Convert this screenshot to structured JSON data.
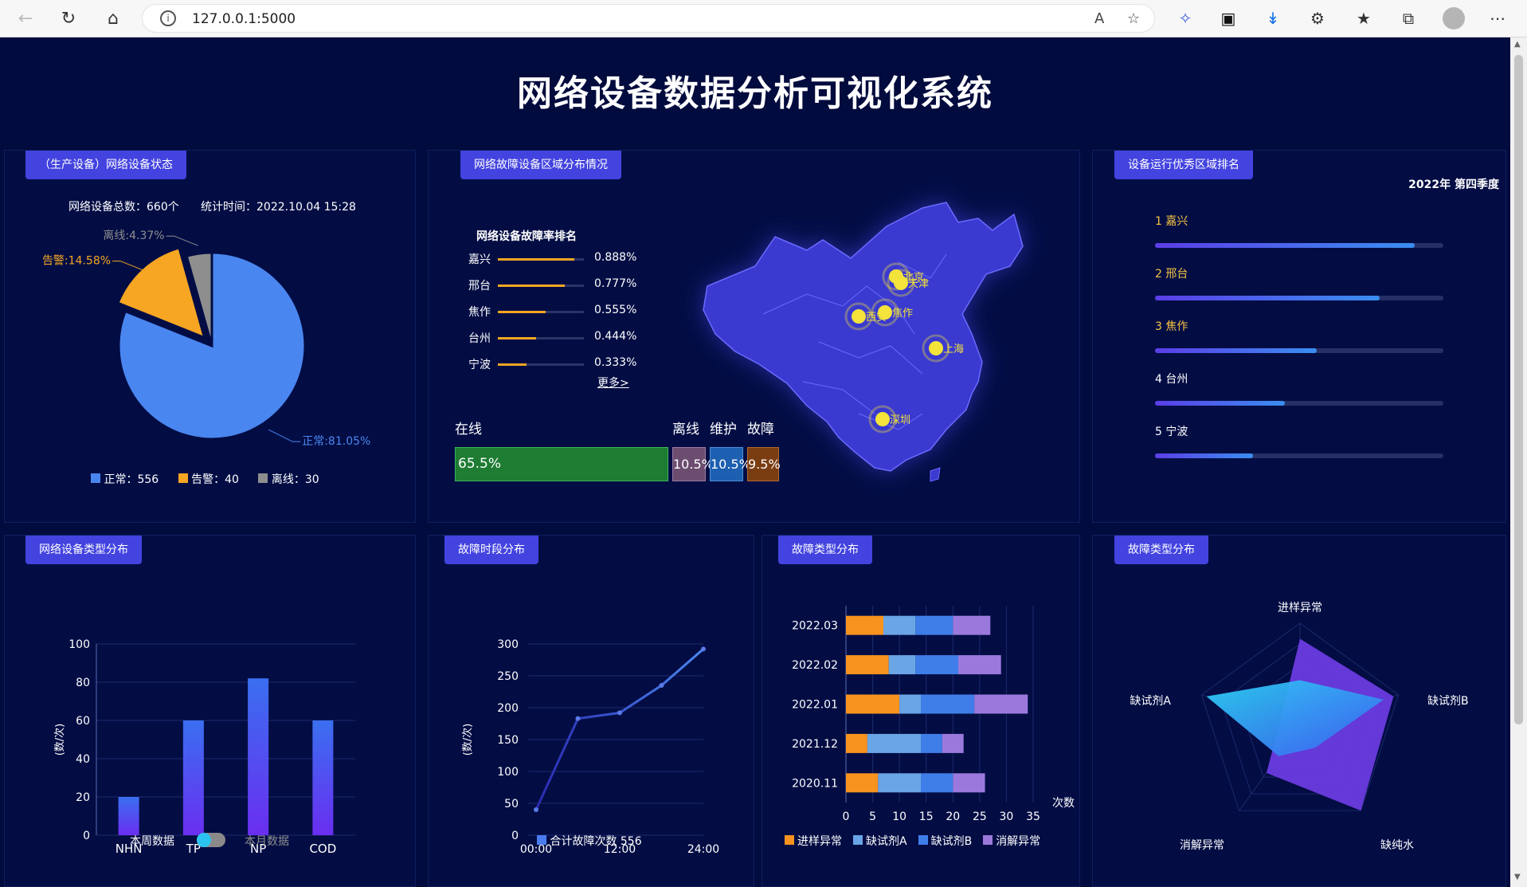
{
  "browser": {
    "url": "127.0.0.1:5000"
  },
  "title": "网络设备数据分析可视化系统",
  "p1": {
    "tag": "（生产设备）网络设备状态",
    "total": "网络设备总数：660个",
    "time": "统计时间：2022.10.04 15:28",
    "slices": [
      {
        "label": "正常:81.05%",
        "value": 81.05,
        "color": "#4a86f0"
      },
      {
        "label": "告警:14.58%",
        "value": 14.58,
        "color": "#f6a623"
      },
      {
        "label": "离线:4.37%",
        "value": 4.37,
        "color": "#8e8e8e"
      }
    ],
    "legend": [
      "正常：556",
      "告警：40",
      "离线：30"
    ]
  },
  "p2": {
    "tag": "网络故障设备区域分布情况",
    "rank_title": "网络设备故障率排名",
    "rank": [
      {
        "city": "嘉兴",
        "value": "0.888%",
        "fill": 0.888
      },
      {
        "city": "邢台",
        "value": "0.777%",
        "fill": 0.777
      },
      {
        "city": "焦作",
        "value": "0.555%",
        "fill": 0.555
      },
      {
        "city": "台州",
        "value": "0.444%",
        "fill": 0.444
      },
      {
        "city": "宁波",
        "value": "0.333%",
        "fill": 0.333
      }
    ],
    "more": "更多>",
    "status_labels": [
      "在线",
      "离线",
      "维护",
      "故障"
    ],
    "status_values": [
      "65.5%",
      "10.5%",
      "10.5%",
      "9.5%"
    ],
    "cities": [
      "北京",
      "天津",
      "西安",
      "焦作",
      "上海",
      "深圳"
    ]
  },
  "p3": {
    "tag": "设备运行优秀区域排名",
    "quarter": "2022年 第四季度",
    "items": [
      {
        "rank": "1",
        "name": "嘉兴",
        "fill": 0.9
      },
      {
        "rank": "2",
        "name": "邢台",
        "fill": 0.78
      },
      {
        "rank": "3",
        "name": "焦作",
        "fill": 0.56
      },
      {
        "rank": "4",
        "name": "台州",
        "fill": 0.45
      },
      {
        "rank": "5",
        "name": "宁波",
        "fill": 0.34
      }
    ]
  },
  "p4": {
    "tag": "网络设备类型分布",
    "ylabel": "(数/次)",
    "toggle_left": "本周数据",
    "toggle_right": "本月数据"
  },
  "p5": {
    "tag": "故障时段分布",
    "ylabel": "(数/次)",
    "legend": "合计故障次数 556"
  },
  "p6": {
    "tag": "故障类型分布",
    "xlabel": "次数",
    "legend": [
      "进样异常",
      "缺试剂A",
      "缺试剂B",
      "消解异常"
    ]
  },
  "p7": {
    "tag": "故障类型分布",
    "indicators": [
      "进样异常",
      "缺试剂B",
      "缺纯水",
      "消解异常",
      "缺试剂A"
    ]
  },
  "chart_data": [
    {
      "type": "bar",
      "categories": [
        "NHN",
        "TP",
        "NP",
        "COD"
      ],
      "values": [
        20,
        60,
        82,
        60
      ],
      "ylim": [
        0,
        100
      ],
      "yticks": [
        "0",
        "20",
        "40",
        "60",
        "80",
        "100"
      ],
      "ylabel": "(数/次)"
    },
    {
      "type": "line",
      "x": [
        "00:00",
        "06:00",
        "12:00",
        "18:00",
        "24:00"
      ],
      "xticks": [
        "00:00",
        "12:00",
        "24:00"
      ],
      "values": [
        40,
        183,
        192,
        235,
        292
      ],
      "ylim": [
        0,
        300
      ],
      "yticks": [
        "0",
        "50",
        "100",
        "150",
        "200",
        "250",
        "300"
      ],
      "ylabel": "(数/次)",
      "series": [
        {
          "name": "合计故障次数 556"
        }
      ]
    },
    {
      "type": "bar",
      "orientation": "horizontal",
      "stacked": true,
      "categories": [
        "2020.11",
        "2021.12",
        "2022.01",
        "2022.02",
        "2022.03"
      ],
      "xlim": [
        0,
        35
      ],
      "xticks": [
        "0",
        "5",
        "10",
        "15",
        "20",
        "25",
        "30",
        "35"
      ],
      "xlabel": "次数",
      "series": [
        {
          "name": "进样异常",
          "values": [
            6,
            4,
            10,
            8,
            7
          ],
          "color": "#f7931e"
        },
        {
          "name": "缺试剂A",
          "values": [
            8,
            10,
            4,
            5,
            6
          ],
          "color": "#6aa5e6"
        },
        {
          "name": "缺试剂B",
          "values": [
            6,
            4,
            10,
            8,
            7
          ],
          "color": "#3f7ee8"
        },
        {
          "name": "消解异常",
          "values": [
            6,
            4,
            10,
            8,
            7
          ],
          "color": "#9b79dc"
        }
      ]
    },
    {
      "type": "radar",
      "indicators": [
        "进样异常",
        "缺试剂B",
        "缺纯水",
        "消解异常",
        "缺试剂A"
      ],
      "series": [
        {
          "values": [
            0.85,
            0.95,
            1.0,
            0.55,
            0.2
          ],
          "color": "#6a3be0"
        },
        {
          "values": [
            0.45,
            0.85,
            0.25,
            0.35,
            0.95
          ],
          "color": "#2aa6f0"
        }
      ]
    }
  ]
}
